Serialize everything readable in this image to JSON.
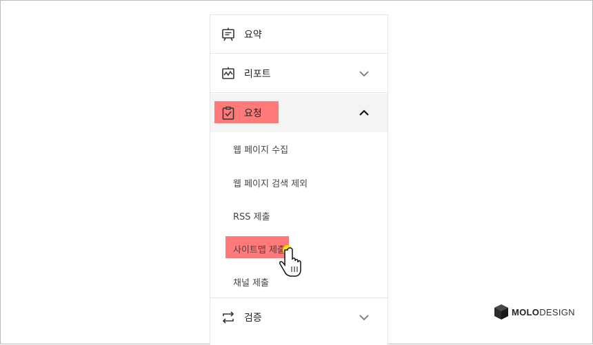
{
  "menu": {
    "summary": {
      "label": "요약",
      "icon": "presentation-board-icon"
    },
    "report": {
      "label": "리포트",
      "icon": "chart-board-icon",
      "chevron": "chevron-down-icon"
    },
    "request": {
      "label": "요청",
      "icon": "clipboard-check-icon",
      "chevron": "chevron-up-icon",
      "subitems": [
        {
          "label": "웹 페이지 수집"
        },
        {
          "label": "웹 페이지 검색 제외"
        },
        {
          "label": "RSS 제출"
        },
        {
          "label": "사이트맵 제출"
        },
        {
          "label": "채널 제출"
        }
      ]
    },
    "verify": {
      "label": "검증",
      "icon": "arrows-swap-icon",
      "chevron": "chevron-down-icon"
    }
  },
  "logo": {
    "bold": "MOLO",
    "light": "DESIGN"
  },
  "colors": {
    "highlight": "#ff7a78",
    "cursor_dot": "#ffe600"
  }
}
